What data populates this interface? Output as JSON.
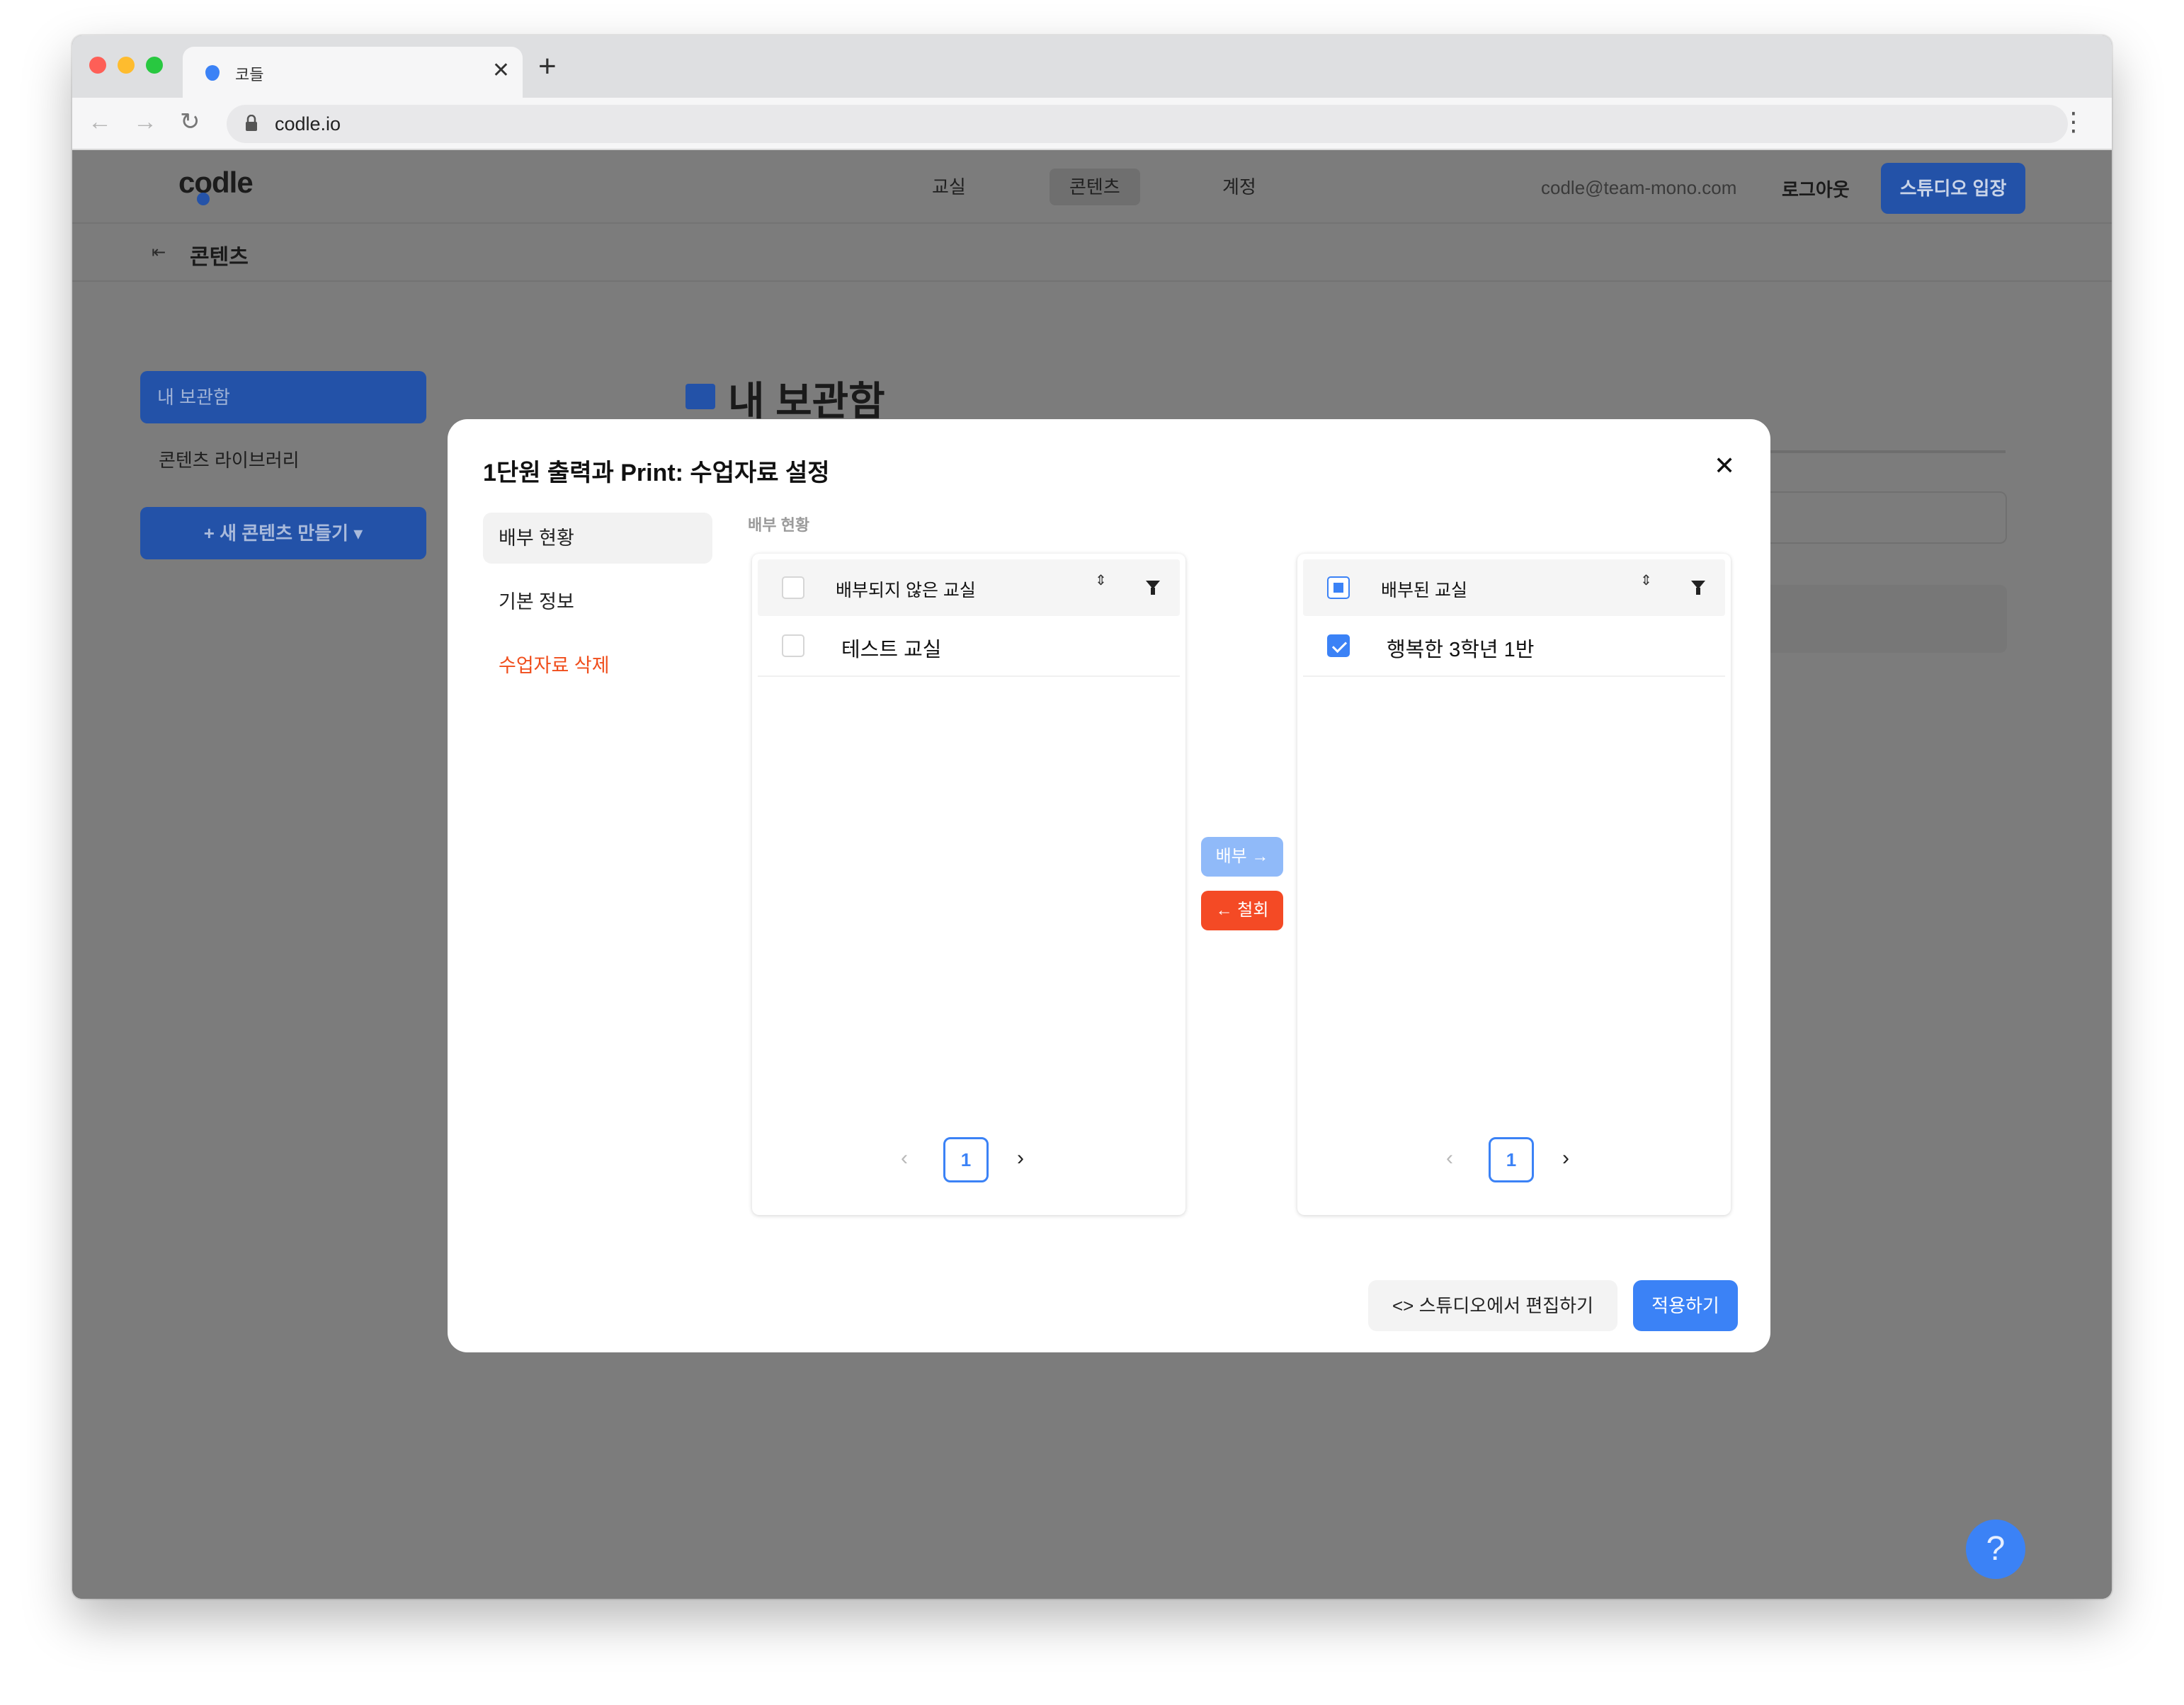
{
  "browser": {
    "tab_title": "코들",
    "tab_close": "✕",
    "new_tab": "+",
    "url": "codle.io",
    "back": "←",
    "forward": "→",
    "reload": "↻",
    "menu": "⋮"
  },
  "header": {
    "logo": "codle",
    "nav": [
      "교실",
      "콘텐츠",
      "계정"
    ],
    "email": "codle@team-mono.com",
    "logout": "로그아웃",
    "studio": "스튜디오 입장"
  },
  "subheader": {
    "icon": "⇤",
    "title": "콘텐츠"
  },
  "sidebar": {
    "active": "내 보관함",
    "library": "콘텐츠 라이브러리",
    "new_content": "+ 새 콘텐츠 만들기 ▾"
  },
  "main": {
    "title": "내 보관함"
  },
  "help": "?",
  "modal": {
    "title": "1단원 출력과 Print: 수업자료 설정",
    "close": "✕",
    "nav": [
      "배부 현황",
      "기본 정보",
      "수업자료 삭제"
    ],
    "section_label": "배부 현황",
    "left_panel": {
      "header": "배부되지 않은 교실",
      "rows": [
        "테스트 교실"
      ],
      "page": "1"
    },
    "right_panel": {
      "header": "배부된 교실",
      "rows": [
        "행복한 3학년 1반"
      ],
      "page": "1"
    },
    "assign_button": "배부 →",
    "revoke_button": "← 철회",
    "edit_button": "<> 스튜디오에서 편집하기",
    "apply_button": "적용하기",
    "pager_prev": "‹",
    "pager_next": "›",
    "sort_glyph": "⇕",
    "colors": {
      "primary": "#3b82f6",
      "danger": "#f44a25",
      "assign_disabled": "#90baf9"
    }
  }
}
